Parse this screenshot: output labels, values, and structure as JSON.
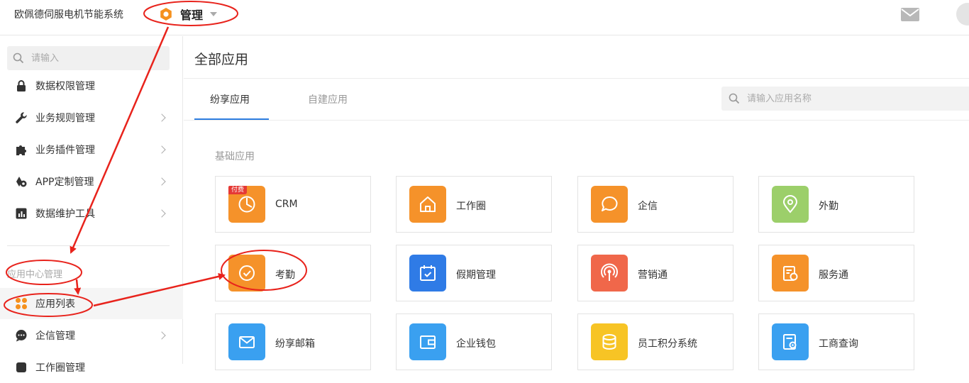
{
  "header": {
    "brand": "欧佩德伺服电机节能系统",
    "mode_label": "管理",
    "mail_icon": "mail-icon",
    "accent": "#f5911e"
  },
  "sidebar": {
    "search_placeholder": "请输入",
    "items": [
      {
        "label": "数据权限管理",
        "icon": "lock-icon",
        "chevron": false
      },
      {
        "label": "业务规则管理",
        "icon": "wrench-icon",
        "chevron": true
      },
      {
        "label": "业务插件管理",
        "icon": "puzzle-icon",
        "chevron": true
      },
      {
        "label": "APP定制管理",
        "icon": "app-custom-icon",
        "chevron": true
      },
      {
        "label": "数据维护工具",
        "icon": "chart-icon",
        "chevron": true
      }
    ],
    "section_title": "应用中心管理",
    "section_items": [
      {
        "label": "应用列表",
        "icon": "apps-grid-icon",
        "active": true
      },
      {
        "label": "企信管理",
        "icon": "chat-icon",
        "chevron": true
      },
      {
        "label": "工作圈管理",
        "icon": "circle-icon"
      }
    ]
  },
  "main": {
    "title": "全部应用",
    "tabs": [
      {
        "label": "纷享应用",
        "active": true
      },
      {
        "label": "自建应用",
        "active": false
      }
    ],
    "app_search_placeholder": "请输入应用名称",
    "group_title": "基础应用",
    "apps": [
      {
        "name": "CRM",
        "color": "#f5922a",
        "icon": "clock-pie-icon",
        "paid_badge": "付费"
      },
      {
        "name": "工作圈",
        "color": "#f5922a",
        "icon": "home-icon"
      },
      {
        "name": "企信",
        "color": "#f5922a",
        "icon": "chat-bubble-icon"
      },
      {
        "name": "外勤",
        "color": "#9ccf6a",
        "icon": "location-pin-icon"
      },
      {
        "name": "考勤",
        "color": "#f5922a",
        "icon": "check-shield-icon"
      },
      {
        "name": "假期管理",
        "color": "#2f7be6",
        "icon": "calendar-check-icon"
      },
      {
        "name": "营销通",
        "color": "#f0674a",
        "icon": "broadcast-icon"
      },
      {
        "name": "服务通",
        "color": "#f5922a",
        "icon": "service-doc-icon"
      },
      {
        "name": "纷享邮箱",
        "color": "#3aa0f0",
        "icon": "envelope-icon"
      },
      {
        "name": "企业钱包",
        "color": "#3aa0f0",
        "icon": "wallet-icon"
      },
      {
        "name": "员工积分系统",
        "color": "#f7c425",
        "icon": "database-icon"
      },
      {
        "name": "工商查询",
        "color": "#3aa0f0",
        "icon": "search-doc-icon"
      }
    ]
  }
}
